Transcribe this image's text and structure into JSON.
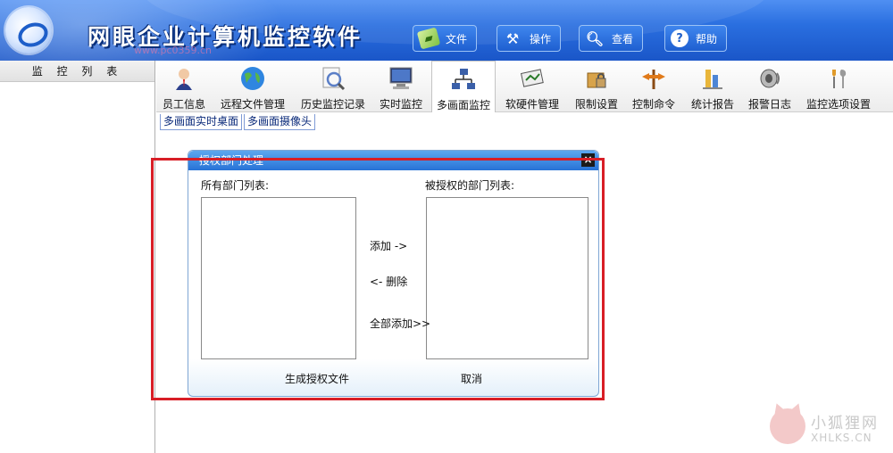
{
  "app": {
    "title": "网眼企业计算机监控软件",
    "watermark_top": "www.pc0359.cn"
  },
  "menu": [
    {
      "label": "文件",
      "icon": "file-icon"
    },
    {
      "label": "操作",
      "icon": "tools-icon"
    },
    {
      "label": "查看",
      "icon": "magnifier-icon"
    },
    {
      "label": "帮助",
      "icon": "help-icon"
    }
  ],
  "left_panel": {
    "title": "监 控 列 表"
  },
  "toolbar": [
    {
      "label": "员工信息",
      "icon": "employee-icon"
    },
    {
      "label": "远程文件管理",
      "icon": "globe-icon"
    },
    {
      "label": "历史监控记录",
      "icon": "history-search-icon"
    },
    {
      "label": "实时监控",
      "icon": "monitor-icon"
    },
    {
      "label": "多画面监控",
      "icon": "network-icon",
      "active": true
    },
    {
      "label": "软硬件管理",
      "icon": "hardware-icon"
    },
    {
      "label": "限制设置",
      "icon": "lock-folder-icon"
    },
    {
      "label": "控制命令",
      "icon": "command-icon"
    },
    {
      "label": "统计报告",
      "icon": "report-icon"
    },
    {
      "label": "报警日志",
      "icon": "speaker-icon"
    },
    {
      "label": "监控选项设置",
      "icon": "settings-icon"
    }
  ],
  "subtabs": [
    "多画面实时桌面",
    "多画面摄像头"
  ],
  "dialog": {
    "title": "授权部门处理",
    "all_label": "所有部门列表:",
    "authorized_label": "被授权的部门列表:",
    "add_label": "添加 ->",
    "remove_label": "<- 删除",
    "add_all_label": "全部添加>>",
    "generate_label": "生成授权文件",
    "cancel_label": "取消",
    "close_label": "×"
  },
  "watermark": {
    "name": "小狐狸网",
    "url": "XHLKS.CN"
  },
  "colors": {
    "header_blue": "#2a6fe0",
    "highlight_red": "#d81e26",
    "dialog_title_blue": "#2772d6"
  }
}
